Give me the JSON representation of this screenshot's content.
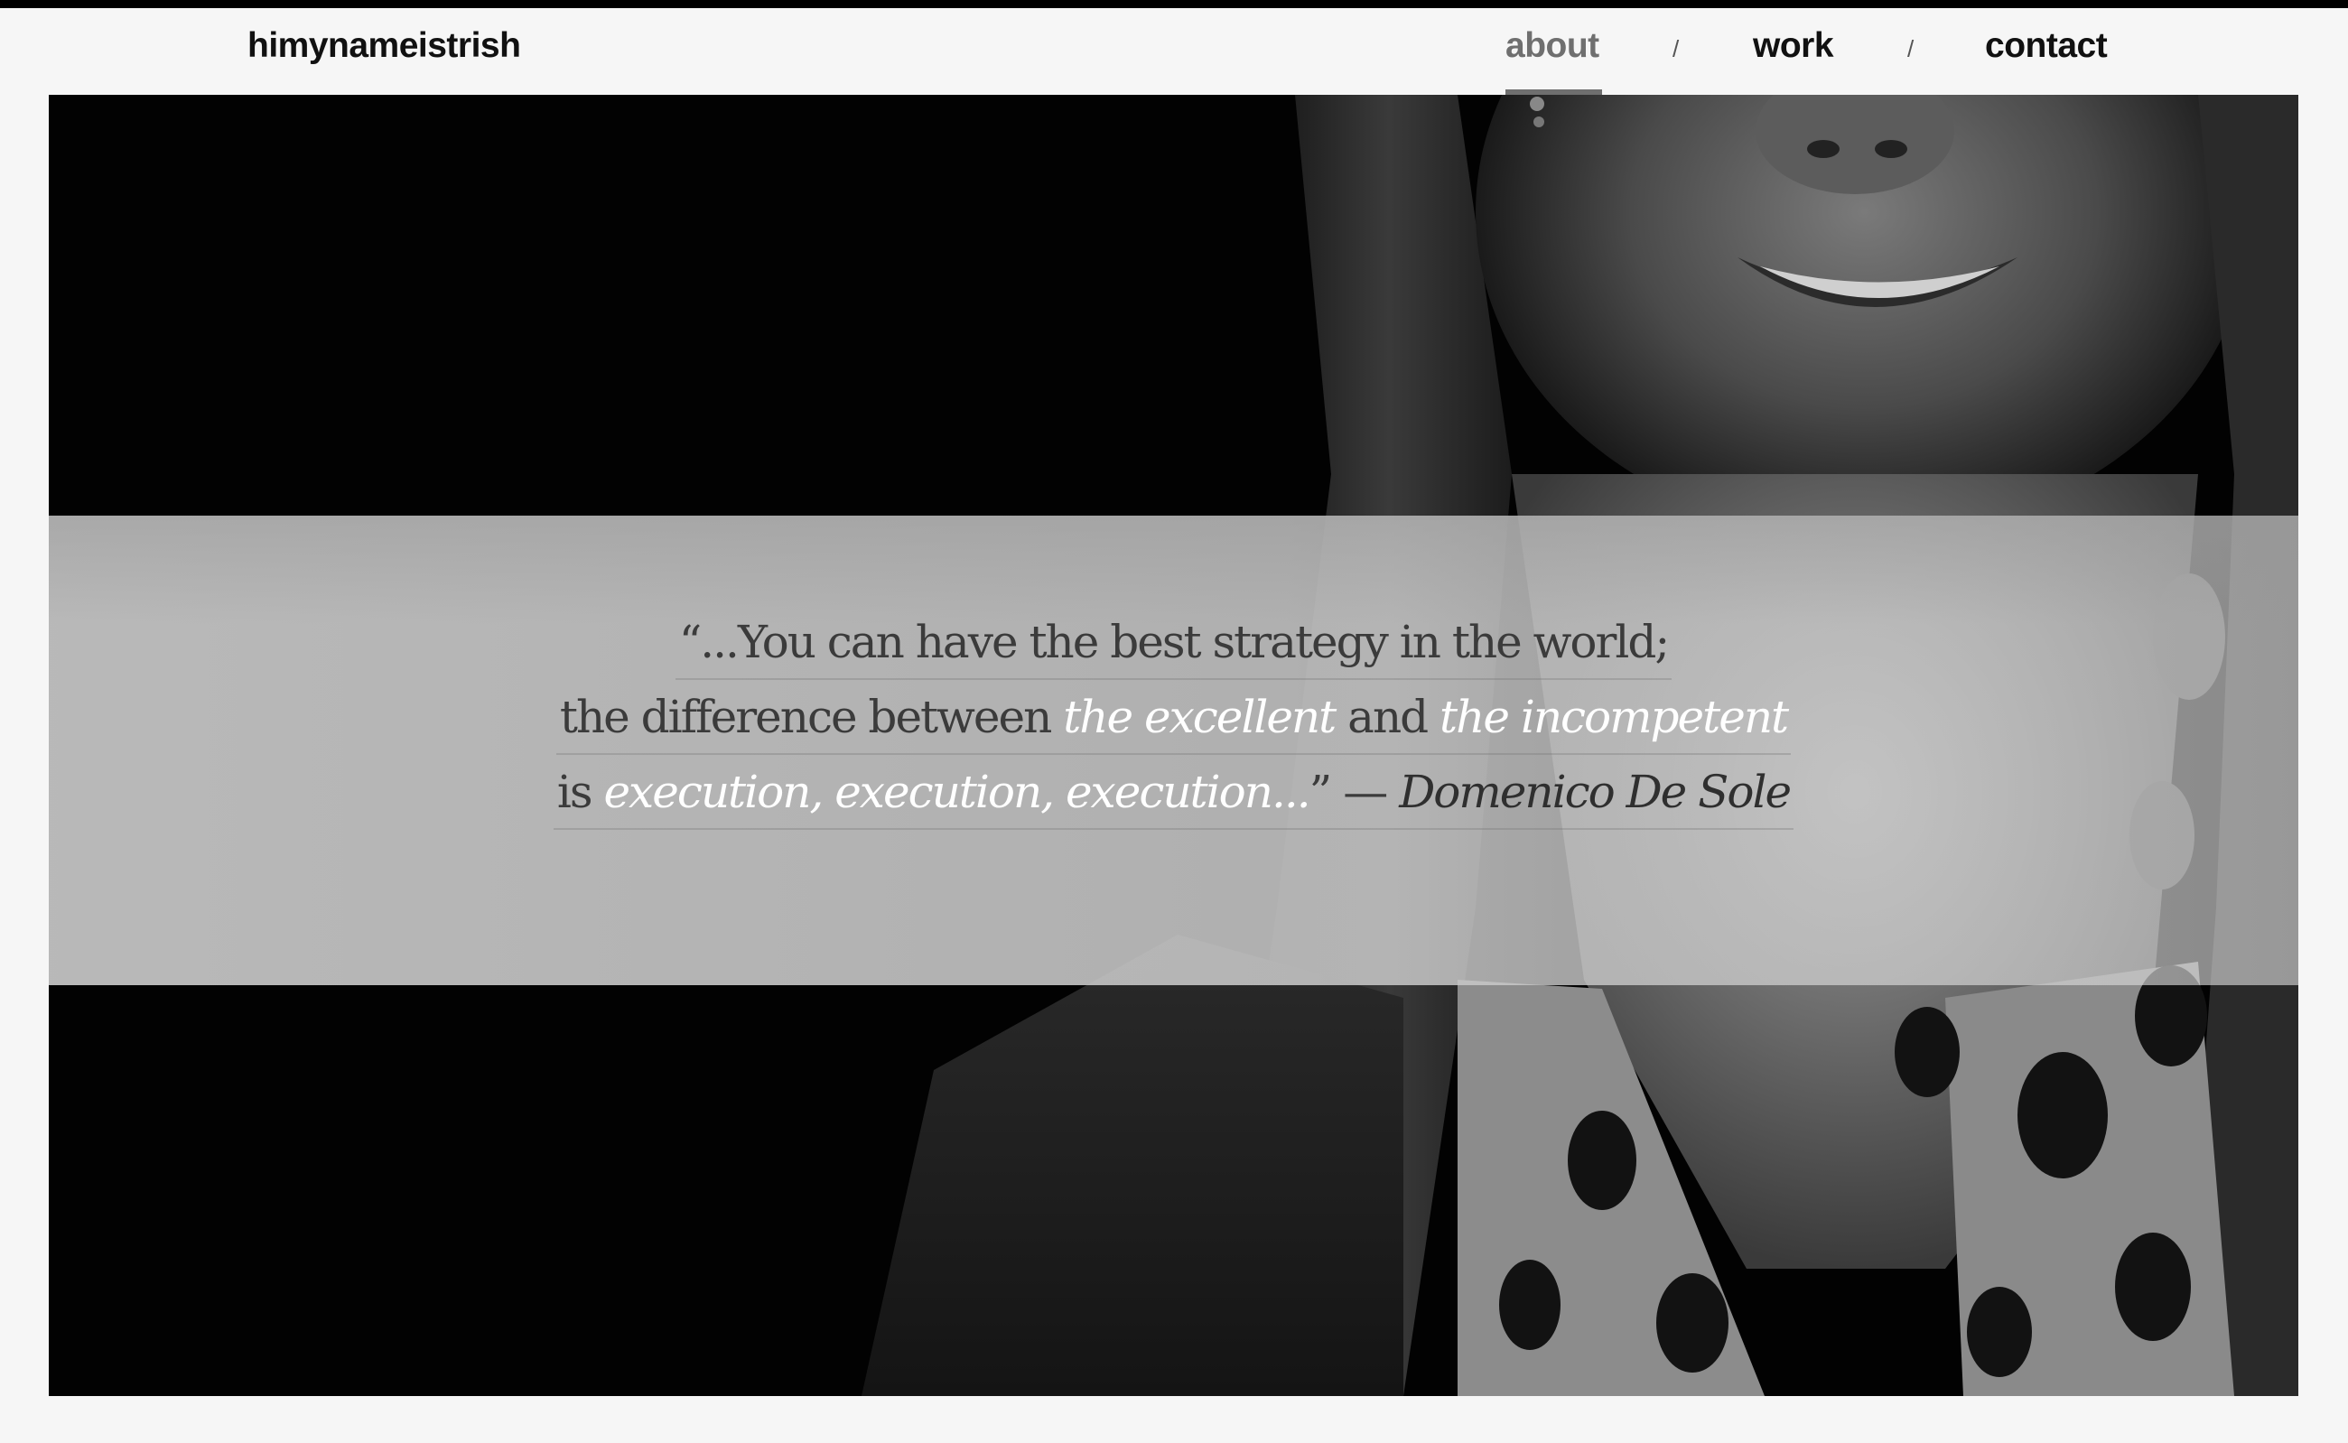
{
  "site": {
    "logo": "himynameistrish"
  },
  "nav": {
    "items": [
      {
        "label": "about",
        "active": true
      },
      {
        "label": "work",
        "active": false
      },
      {
        "label": "contact",
        "active": false
      }
    ],
    "separator": "/"
  },
  "quote": {
    "line1": "“...You can have the best strategy in the world;",
    "line2_a": "the difference between ",
    "line2_em1": "the excellent",
    "line2_b": " and ",
    "line2_em2": "the incompetent",
    "line3_a": "is ",
    "line3_em": "execution, execution, execution...",
    "line3_close": "”",
    "dash": "—",
    "author": "Domenico De Sole"
  },
  "colors": {
    "nav_active": "#6f6f6f",
    "text": "#111111",
    "quote_text": "#3b3b3b",
    "quote_emphasis": "#ffffff"
  }
}
